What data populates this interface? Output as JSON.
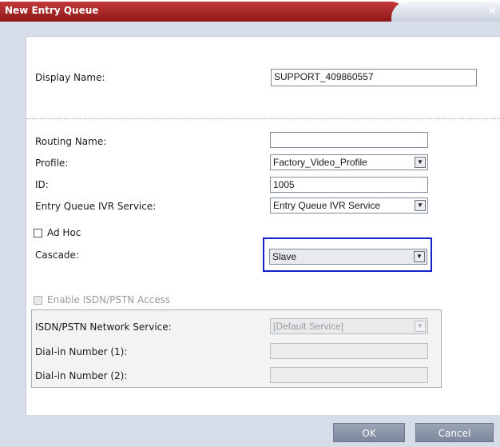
{
  "window": {
    "title": "New Entry Queue",
    "close_glyph": "✕"
  },
  "form": {
    "display_name": {
      "label": "Display Name:",
      "value": "SUPPORT_409860557"
    },
    "routing_name": {
      "label": "Routing Name:",
      "value": ""
    },
    "profile": {
      "label": "Profile:",
      "value": "Factory_Video_Profile"
    },
    "id": {
      "label": "ID:",
      "value": "1005"
    },
    "ivr_service": {
      "label": "Entry Queue IVR Service:",
      "value": "Entry Queue IVR Service"
    },
    "ad_hoc": {
      "label": "Ad Hoc",
      "checked": false
    },
    "cascade": {
      "label": "Cascade:",
      "value": "Slave"
    },
    "isdn_enable": {
      "label": "Enable ISDN/PSTN Access",
      "checked": false,
      "enabled": false
    },
    "network_service": {
      "label": "ISDN/PSTN Network Service:",
      "value": "[Default Service]"
    },
    "dialin_1": {
      "label": "Dial-in Number (1):",
      "value": ""
    },
    "dialin_2": {
      "label": "Dial-in Number (2):",
      "value": ""
    }
  },
  "buttons": {
    "ok": "OK",
    "cancel": "Cancel"
  },
  "icons": {
    "dropdown_arrow": "▼"
  },
  "colors": {
    "title_bar": "#a82424",
    "highlight": "#1122cc",
    "button": "#8a94a8"
  }
}
